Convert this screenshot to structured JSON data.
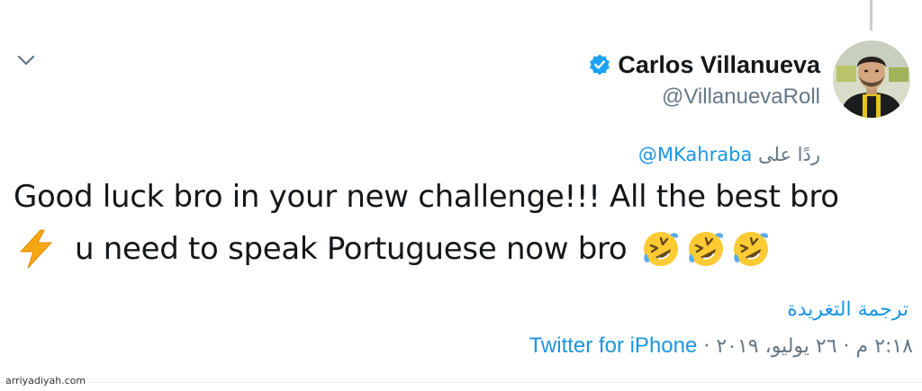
{
  "tweet": {
    "author": {
      "display_name": "Carlos Villanueva",
      "handle": "@VillanuevaRoll",
      "verified": true,
      "verified_icon": "verified-badge-icon"
    },
    "reply_prefix": "ردًا على",
    "reply_to_handle": "@MKahraba",
    "text_line1": "Good luck bro in your new challenge!!! All the best bro",
    "text_line2": "u need to speak Portuguese now bro",
    "emojis": [
      "high-voltage-emoji",
      "rolling-on-floor-laughing-emoji",
      "rolling-on-floor-laughing-emoji",
      "rolling-on-floor-laughing-emoji"
    ],
    "translate_label": "ترجمة التغريدة",
    "timestamp": "٢:١٨ م · ٢٦ يوليو، ٢٠١٩ ·",
    "source": "Twitter for iPhone"
  },
  "watermark": "arriyadiyah.com",
  "colors": {
    "link": "#1b95e0",
    "secondary_text": "#657786",
    "primary_text": "#14171a"
  }
}
